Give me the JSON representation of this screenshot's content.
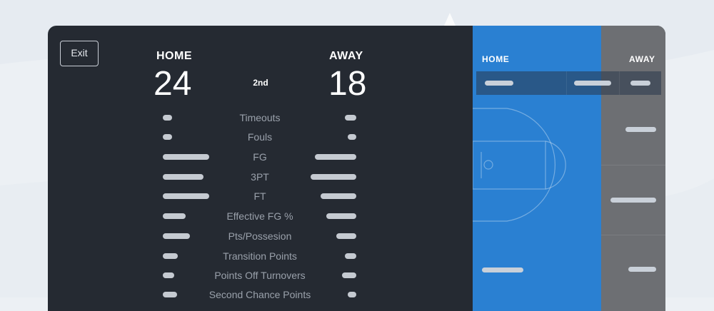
{
  "exit_label": "Exit",
  "home": {
    "label": "HOME",
    "score": "24"
  },
  "away": {
    "label": "AWAY",
    "score": "18"
  },
  "period": "2nd",
  "stats": [
    {
      "label": "Timeouts"
    },
    {
      "label": "Fouls"
    },
    {
      "label": "FG"
    },
    {
      "label": "3PT"
    },
    {
      "label": "FT"
    },
    {
      "label": "Effective FG %"
    },
    {
      "label": "Pts/Possesion"
    },
    {
      "label": "Transition Points"
    },
    {
      "label": "Points Off Turnovers"
    },
    {
      "label": "Second Chance Points"
    }
  ],
  "right_panel": {
    "home_heading": "HOME",
    "away_heading": "AWAY"
  },
  "colors": {
    "panel": "#252a32",
    "court": "#2a80d2",
    "away_column": "#6d6f73",
    "background": "#ecf0f4"
  }
}
